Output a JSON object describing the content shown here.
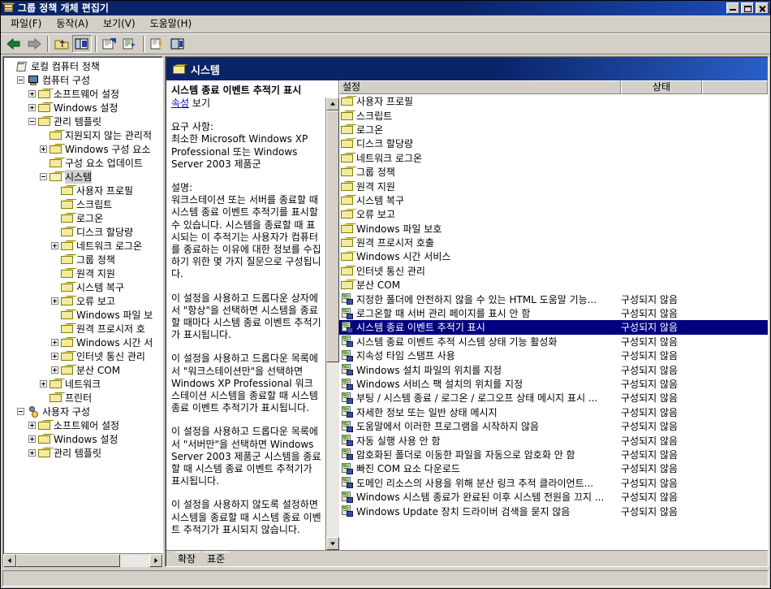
{
  "window": {
    "title": "그룹 정책 개체 편집기",
    "icon": "group-policy-icon",
    "minimize_label": "최소화",
    "maximize_label": "최대화",
    "close_label": "닫기"
  },
  "menubar": [
    {
      "label": "파일(F)",
      "name": "menu-file"
    },
    {
      "label": "동작(A)",
      "name": "menu-action"
    },
    {
      "label": "보기(V)",
      "name": "menu-view"
    },
    {
      "label": "도움말(H)",
      "name": "menu-help"
    }
  ],
  "toolbar": [
    {
      "name": "back-icon",
      "label": "뒤로"
    },
    {
      "name": "forward-icon",
      "label": "앞으로"
    },
    {
      "name": "up-one-level-icon",
      "label": "한 수준 위로"
    },
    {
      "name": "show-hide-tree-icon",
      "label": "콘솔 트리 표시/숨기기"
    },
    {
      "name": "properties-icon",
      "label": "속성"
    },
    {
      "name": "export-list-icon",
      "label": "목록 내보내기"
    },
    {
      "name": "help-icon",
      "label": "도움말"
    },
    {
      "name": "view-pane-icon",
      "label": "보기"
    }
  ],
  "tree": {
    "nodes": [
      {
        "label": "로컬 컴퓨터 정책",
        "depth": 0,
        "expander": "none",
        "icon": "policy-scroll-icon",
        "selected": false
      },
      {
        "label": "컴퓨터 구성",
        "depth": 1,
        "expander": "minus",
        "icon": "computer-icon",
        "selected": false
      },
      {
        "label": "소프트웨어 설정",
        "depth": 2,
        "expander": "plus",
        "icon": "folder-icon",
        "selected": false
      },
      {
        "label": "Windows 설정",
        "depth": 2,
        "expander": "plus",
        "icon": "folder-icon",
        "selected": false
      },
      {
        "label": "관리 템플릿",
        "depth": 2,
        "expander": "minus",
        "icon": "folder-icon",
        "selected": false
      },
      {
        "label": "지원되지 않는 관리적",
        "depth": 3,
        "expander": "none",
        "icon": "folder-icon",
        "selected": false
      },
      {
        "label": "Windows 구성 요소",
        "depth": 3,
        "expander": "plus",
        "icon": "folder-icon",
        "selected": false
      },
      {
        "label": "구성 요소 업데이트",
        "depth": 3,
        "expander": "none",
        "icon": "folder-icon",
        "selected": false
      },
      {
        "label": "시스템",
        "depth": 3,
        "expander": "minus",
        "icon": "folder-open-icon",
        "selected": true
      },
      {
        "label": "사용자 프로필",
        "depth": 4,
        "expander": "none",
        "icon": "folder-icon",
        "selected": false
      },
      {
        "label": "스크립트",
        "depth": 4,
        "expander": "none",
        "icon": "folder-icon",
        "selected": false
      },
      {
        "label": "로그온",
        "depth": 4,
        "expander": "none",
        "icon": "folder-icon",
        "selected": false
      },
      {
        "label": "디스크 할당량",
        "depth": 4,
        "expander": "none",
        "icon": "folder-icon",
        "selected": false
      },
      {
        "label": "네트워크 로그온",
        "depth": 4,
        "expander": "plus",
        "icon": "folder-icon",
        "selected": false
      },
      {
        "label": "그룹 정책",
        "depth": 4,
        "expander": "none",
        "icon": "folder-icon",
        "selected": false
      },
      {
        "label": "원격 지원",
        "depth": 4,
        "expander": "none",
        "icon": "folder-icon",
        "selected": false
      },
      {
        "label": "시스템 복구",
        "depth": 4,
        "expander": "none",
        "icon": "folder-icon",
        "selected": false
      },
      {
        "label": "오류 보고",
        "depth": 4,
        "expander": "plus",
        "icon": "folder-icon",
        "selected": false
      },
      {
        "label": "Windows 파일 보",
        "depth": 4,
        "expander": "none",
        "icon": "folder-icon",
        "selected": false
      },
      {
        "label": "원격 프로시저 호",
        "depth": 4,
        "expander": "none",
        "icon": "folder-icon",
        "selected": false
      },
      {
        "label": "Windows 시간 서",
        "depth": 4,
        "expander": "plus",
        "icon": "folder-icon",
        "selected": false
      },
      {
        "label": "인터넷 통신 관리",
        "depth": 4,
        "expander": "plus",
        "icon": "folder-icon",
        "selected": false
      },
      {
        "label": "분산 COM",
        "depth": 4,
        "expander": "plus",
        "icon": "folder-icon",
        "selected": false
      },
      {
        "label": "네트워크",
        "depth": 3,
        "expander": "plus",
        "icon": "folder-icon",
        "selected": false
      },
      {
        "label": "프린터",
        "depth": 3,
        "expander": "none",
        "icon": "folder-icon",
        "selected": false
      },
      {
        "label": "사용자 구성",
        "depth": 1,
        "expander": "minus",
        "icon": "user-config-icon",
        "selected": false
      },
      {
        "label": "소프트웨어 설정",
        "depth": 2,
        "expander": "plus",
        "icon": "folder-icon",
        "selected": false
      },
      {
        "label": "Windows 설정",
        "depth": 2,
        "expander": "plus",
        "icon": "folder-icon",
        "selected": false
      },
      {
        "label": "관리 템플릿",
        "depth": 2,
        "expander": "plus",
        "icon": "folder-icon",
        "selected": false
      }
    ]
  },
  "right_header": {
    "title": "시스템",
    "icon": "folder-icon"
  },
  "description": {
    "title": "시스템 종료 이벤트 추적기 표시",
    "link_text": "속성",
    "link_suffix": " 보기",
    "requirements_label": "요구 사항:",
    "requirements_text": "최소한 Microsoft Windows XP Professional 또는 Windows Server 2003 제품군",
    "explain_label": "설명:",
    "paragraphs": [
      "워크스테이션 또는 서버를 종료할 때 시스템 종료 이벤트 추적기를 표시할 수 있습니다. 시스템을 종료할 때 표시되는 이 추적기는 사용자가 컴퓨터를 종료하는 이유에 대한 정보를 수집하기 위한 몇 가지 질문으로 구성됩니다.",
      "이 설정을 사용하고 드롭다운 상자에서 \"항상\"을 선택하면 시스템을 종료할 때마다 시스템 종료 이벤트 추적기가 표시됩니다.",
      "이 설정을 사용하고 드롭다운 목록에서 \"워크스테이션만\"을 선택하면 Windows XP Professional 워크스테이션 시스템을 종료할 때 시스템 종료 이벤트 추적기가 표시됩니다.",
      "이 설정을 사용하고 드롭다운 목록에서 \"서버만\"을 선택하면 Windows Server 2003 제품군 시스템을 종료할 때 시스템 종료 이벤트 추적기가 표시됩니다.",
      "이 설정을 사용하지 않도록 설정하면 시스템을 종료할 때 시스템 종료 이벤트 추적기가 표시되지 않습니다."
    ]
  },
  "list": {
    "columns": [
      {
        "label": "설정",
        "name": "column-setting"
      },
      {
        "label": "상태",
        "name": "column-state"
      },
      {
        "label": "",
        "name": "column-extra"
      }
    ],
    "rows": [
      {
        "label": "사용자 프로필",
        "state": "",
        "type": "folder",
        "selected": false
      },
      {
        "label": "스크립트",
        "state": "",
        "type": "folder",
        "selected": false
      },
      {
        "label": "로그온",
        "state": "",
        "type": "folder",
        "selected": false
      },
      {
        "label": "디스크 할당량",
        "state": "",
        "type": "folder",
        "selected": false
      },
      {
        "label": "네트워크 로그온",
        "state": "",
        "type": "folder",
        "selected": false
      },
      {
        "label": "그룹 정책",
        "state": "",
        "type": "folder",
        "selected": false
      },
      {
        "label": "원격 지원",
        "state": "",
        "type": "folder",
        "selected": false
      },
      {
        "label": "시스템 복구",
        "state": "",
        "type": "folder",
        "selected": false
      },
      {
        "label": "오류 보고",
        "state": "",
        "type": "folder",
        "selected": false
      },
      {
        "label": "Windows 파일 보호",
        "state": "",
        "type": "folder",
        "selected": false
      },
      {
        "label": "원격 프로시저 호출",
        "state": "",
        "type": "folder",
        "selected": false
      },
      {
        "label": "Windows 시간 서비스",
        "state": "",
        "type": "folder",
        "selected": false
      },
      {
        "label": "인터넷 통신 관리",
        "state": "",
        "type": "folder",
        "selected": false
      },
      {
        "label": "분산 COM",
        "state": "",
        "type": "folder",
        "selected": false
      },
      {
        "label": "지정한 폴더에 안전하지 않을 수 있는 HTML 도움말 기능...",
        "state": "구성되지 않음",
        "type": "policy",
        "selected": false
      },
      {
        "label": "로그온할 때 서버 관리 페이지를 표시 안 함",
        "state": "구성되지 않음",
        "type": "policy",
        "selected": false
      },
      {
        "label": "시스템 종료 이벤트 추적기 표시",
        "state": "구성되지 않음",
        "type": "policy",
        "selected": true
      },
      {
        "label": "시스템 종료 이벤트 추적 시스템 상태 기능 활성화",
        "state": "구성되지 않음",
        "type": "policy",
        "selected": false
      },
      {
        "label": "지속성 타임 스탬프 사용",
        "state": "구성되지 않음",
        "type": "policy",
        "selected": false
      },
      {
        "label": "Windows 설치 파일의 위치를 지정",
        "state": "구성되지 않음",
        "type": "policy",
        "selected": false
      },
      {
        "label": "Windows 서비스 팩 설치의 위치를 지정",
        "state": "구성되지 않음",
        "type": "policy",
        "selected": false
      },
      {
        "label": "부팅 / 시스템 종료 / 로그온 / 로그오프 상태 메시지 표시 ...",
        "state": "구성되지 않음",
        "type": "policy",
        "selected": false
      },
      {
        "label": "자세한 정보 또는 일반 상태 메시지",
        "state": "구성되지 않음",
        "type": "policy",
        "selected": false
      },
      {
        "label": "도움말에서 이러한 프로그램을 시작하지 않음",
        "state": "구성되지 않음",
        "type": "policy",
        "selected": false
      },
      {
        "label": "자동 실행 사용 안 함",
        "state": "구성되지 않음",
        "type": "policy",
        "selected": false
      },
      {
        "label": "암호화된 폴더로 이동한 파일을 자동으로 암호화 안 함",
        "state": "구성되지 않음",
        "type": "policy",
        "selected": false
      },
      {
        "label": "빠진 COM 요소 다운로드",
        "state": "구성되지 않음",
        "type": "policy",
        "selected": false
      },
      {
        "label": "도메인 리소스의 사용을 위해 분산 링크 추적 클라이언트...",
        "state": "구성되지 않음",
        "type": "policy",
        "selected": false
      },
      {
        "label": "Windows 시스템 종료가 완료된 이후 시스템 전원을 끄지 ...",
        "state": "구성되지 않음",
        "type": "policy",
        "selected": false
      },
      {
        "label": "Windows Update 장치 드라이버 검색을 묻지 않음",
        "state": "구성되지 않음",
        "type": "policy",
        "selected": false
      }
    ]
  },
  "tabs": [
    {
      "label": "확장",
      "name": "tab-extended",
      "active": false
    },
    {
      "label": "표준",
      "name": "tab-standard",
      "active": true
    }
  ],
  "statusbar": {
    "text": ""
  },
  "colors": {
    "titlebar_start": "#0a246a",
    "titlebar_end": "#1c4fbb",
    "face": "#d4d0c8",
    "selection": "#000080",
    "link": "#0000cc",
    "folder": "#f5e9a0"
  }
}
